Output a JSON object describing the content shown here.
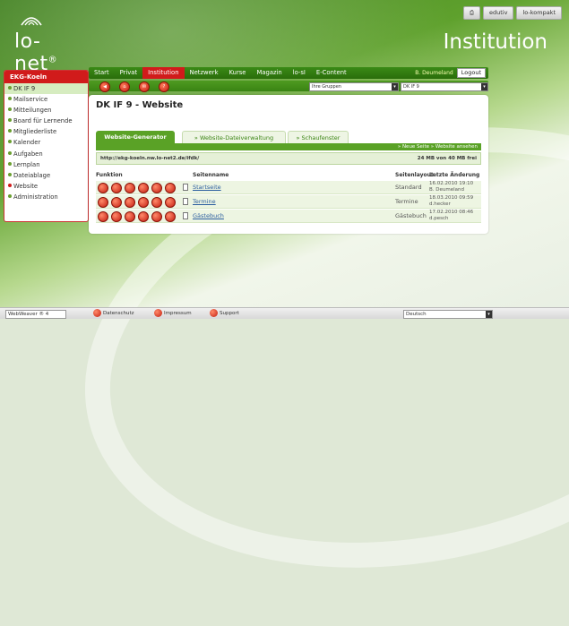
{
  "header": {
    "logo": "lo-net",
    "logo_mark": "®",
    "section": "Institution",
    "buttons": [
      "edutiv",
      "lo-kompakt"
    ]
  },
  "sidebar": {
    "title": "EKG-Koeln",
    "items": [
      {
        "label": "DK IF 9",
        "selected": true
      },
      {
        "label": "Mailservice"
      },
      {
        "label": "Mitteilungen"
      },
      {
        "label": "Board für Lernende"
      },
      {
        "label": "Mitgliederliste"
      },
      {
        "label": "Kalender"
      },
      {
        "label": "Aufgaben"
      },
      {
        "label": "Lernplan"
      },
      {
        "label": "Dateiablage"
      },
      {
        "label": "Website",
        "active": true
      },
      {
        "label": "Administration"
      }
    ]
  },
  "nav": {
    "items": [
      "Start",
      "Privat",
      "Institution",
      "Netzwerk",
      "Kurse",
      "Magazin",
      "lo-sI",
      "E-Content"
    ],
    "active": "Institution",
    "user": "B. Deumeland",
    "logout": "Logout"
  },
  "subbar": {
    "group_select": "Ihre Gruppen",
    "course_select": "DK IF 9"
  },
  "main": {
    "title": "DK IF 9 - Website",
    "tabs": [
      "Website-Generator",
      "Website-Dateiverwaltung",
      "Schaufenster"
    ],
    "actions": "» Neue Seite  » Website ansehen",
    "url": "http://ekg-koeln.nw.lo-net2.de/ifdk/",
    "storage": "24 MB von 40 MB frei",
    "table_headers": {
      "function": "Funktion",
      "page_name": "Seitenname",
      "layout": "Seitenlayout",
      "changed": "Letzte Änderung"
    },
    "rows": [
      {
        "name": "Startseite",
        "layout": "Standard",
        "date": "16.02.2010 19:10",
        "user": "B. Deumeland"
      },
      {
        "name": "Termine",
        "layout": "Termine",
        "date": "18.03.2010 09:59",
        "user": "d.hecker"
      },
      {
        "name": "Gästebuch",
        "layout": "Gästebuch",
        "date": "17.02.2010 08:46",
        "user": "d.pesch"
      }
    ]
  },
  "footer": {
    "version": "WebWeaver ® 4",
    "links": [
      "Datenschutz",
      "Impressum",
      "Support"
    ],
    "language": "Deutsch"
  },
  "colors": {
    "brand_red": "#d11b1b",
    "brand_green": "#3a8413"
  }
}
